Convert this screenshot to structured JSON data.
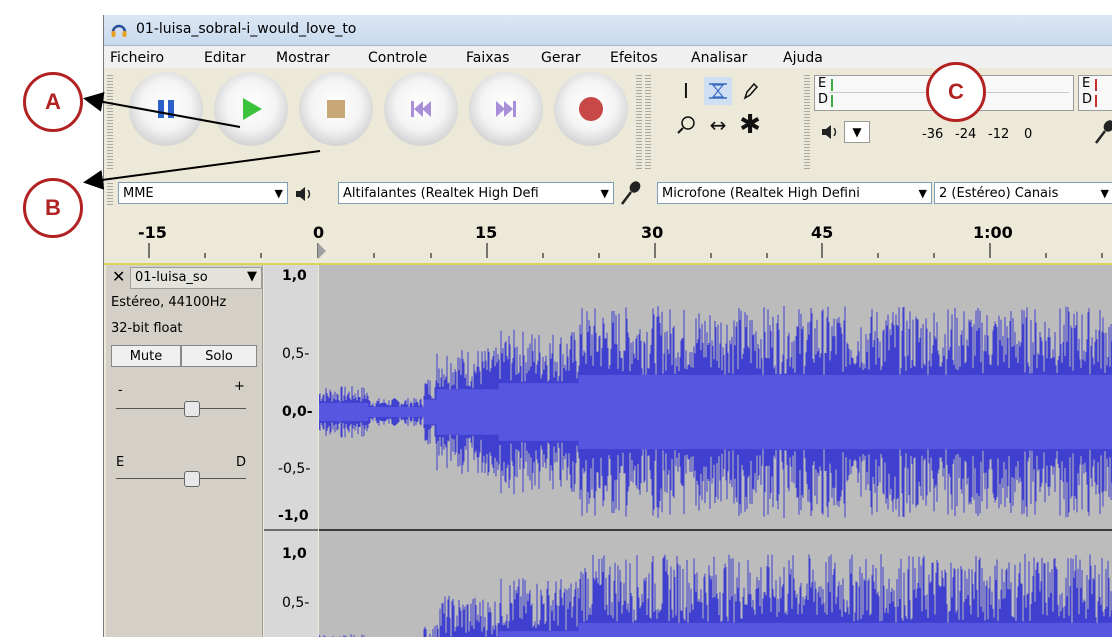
{
  "window": {
    "title": "01-luisa_sobral-i_would_love_to"
  },
  "menubar": {
    "items": [
      "Ficheiro",
      "Editar",
      "Mostrar",
      "Controle",
      "Faixas",
      "Gerar",
      "Efeitos",
      "Analisar",
      "Ajuda"
    ]
  },
  "transport": {
    "buttons": [
      "pause",
      "play",
      "stop",
      "skip-to-start",
      "skip-to-end",
      "record"
    ]
  },
  "meter": {
    "playback_left": "E",
    "playback_right": "D",
    "record_left": "E",
    "record_right": "D",
    "scale": [
      "-36",
      "-24",
      "-12",
      "0"
    ]
  },
  "devices": {
    "host": "MME",
    "output": "Altifalantes (Realtek High Defi",
    "input": "Microfone (Realtek High Defini",
    "channels": "2 (Estéreo) Canais"
  },
  "ruler": {
    "labels": [
      "-15",
      "0",
      "15",
      "30",
      "45",
      "1:00"
    ]
  },
  "track": {
    "name": "01-luisa_so",
    "format": "Estéreo, 44100Hz",
    "bits": "32-bit float",
    "mute_label": "Mute",
    "solo_label": "Solo",
    "gain_minus": "-",
    "gain_plus": "+",
    "pan_left": "E",
    "pan_right": "D",
    "scale_top": [
      "1,0",
      "0,5-",
      "0,0-",
      "-0,5-",
      "-1,0"
    ],
    "scale_bottom": [
      "1,0",
      "0,5-"
    ]
  },
  "callouts": {
    "a": "A",
    "b": "B",
    "c": "C"
  },
  "colors": {
    "waveform": "#3f3fd0",
    "callout": "#b22222"
  }
}
